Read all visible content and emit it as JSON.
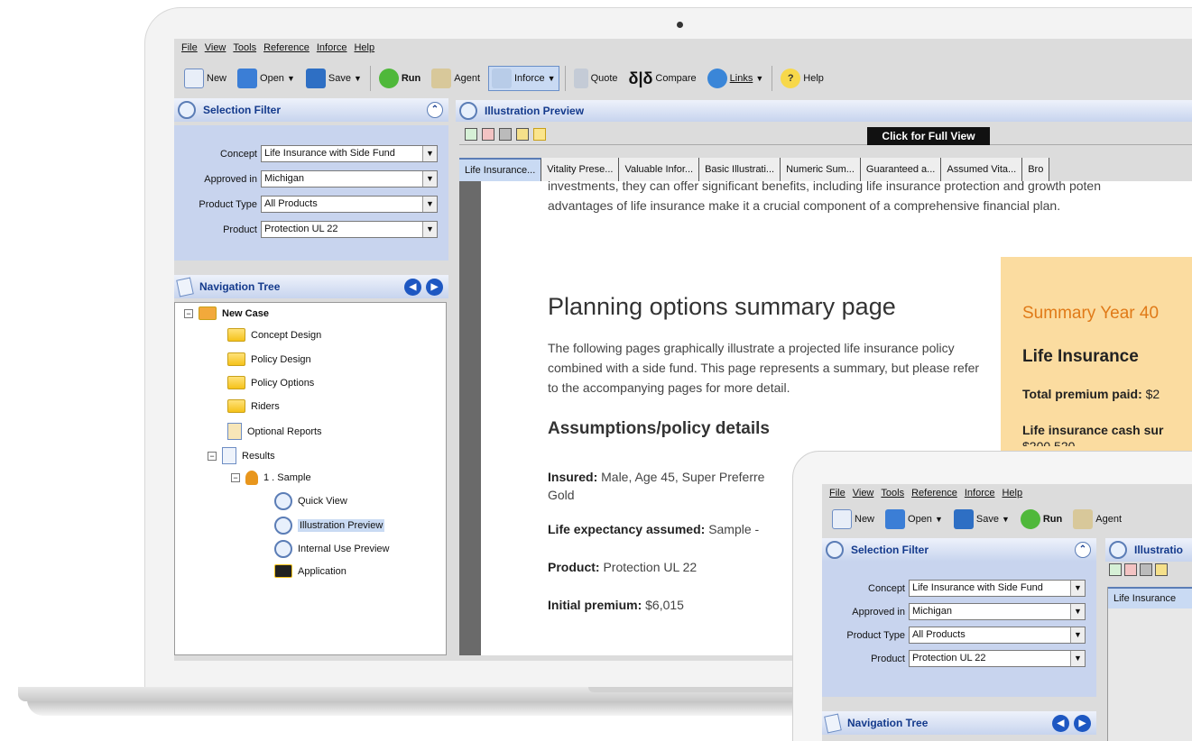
{
  "menu": [
    "File",
    "View",
    "Tools",
    "Reference",
    "Inforce",
    "Help"
  ],
  "toolbar": {
    "new": "New",
    "open": "Open",
    "save": "Save",
    "run": "Run",
    "agent": "Agent",
    "inforce": "Inforce",
    "quote": "Quote",
    "compare": "Compare",
    "links": "Links",
    "help": "Help"
  },
  "selection_filter": {
    "title": "Selection Filter",
    "concept_label": "Concept",
    "concept": "Life Insurance with Side Fund",
    "approved_label": "Approved in",
    "approved": "Michigan",
    "type_label": "Product Type",
    "type": "All Products",
    "product_label": "Product",
    "product": "Protection UL 22"
  },
  "nav": {
    "title": "Navigation Tree",
    "root": "New Case",
    "items": [
      "Concept Design",
      "Policy Design",
      "Policy Options",
      "Riders",
      "Optional Reports",
      "Results"
    ],
    "sample": "1 . Sample",
    "sub": [
      "Quick View",
      "Illustration Preview",
      "Internal Use Preview",
      "Application"
    ]
  },
  "preview": {
    "title": "Illustration Preview",
    "full_view": "Click for Full View",
    "tabs": [
      "Life Insurance...",
      "Vitality Prese...",
      "Valuable Infor...",
      "Basic Illustrati...",
      "Numeric Sum...",
      "Guaranteed a...",
      "Assumed Vita...",
      "Bro"
    ]
  },
  "doc": {
    "intro1": "investments, they can offer significant benefits, including life insurance protection and growth poten",
    "intro2": "advantages of life insurance make it a crucial component of a comprehensive financial plan.",
    "heading": "Planning options summary page",
    "para": "The following pages graphically illustrate a projected life insurance policy combined with a side fund. This page represents a summary, but please refer to the accompanying pages for more detail.",
    "subheading": "Assumptions/policy details",
    "insured_label": "Insured:",
    "insured": "Male, Age 45, Super Preferre",
    "insured_cont": "Gold",
    "le_label": "Life expectancy assumed:",
    "le": "Sample -",
    "product_label": "Product:",
    "product": "Protection UL 22",
    "premium_label": "Initial premium:",
    "premium": "$6,015",
    "summary_title": "Summary Year 40",
    "summary_heading": "Life Insurance",
    "total_label": "Total premium paid:",
    "total": "$2",
    "cash_label": "Life insurance cash sur",
    "cash_partial": "$200,520"
  },
  "tablet": {
    "tab": "Life Insurance",
    "illus": "Illustratio"
  }
}
